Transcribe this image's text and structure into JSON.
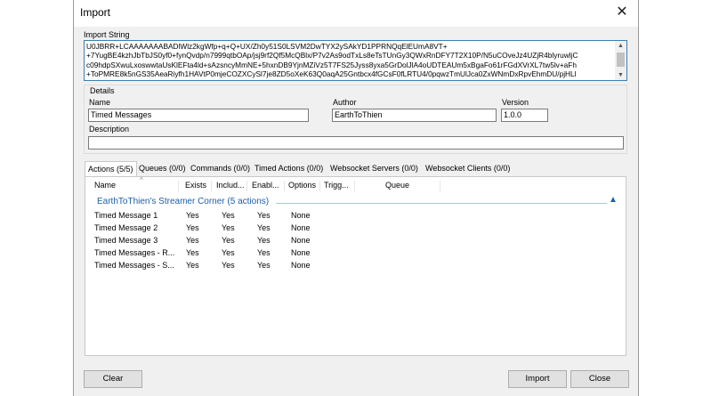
{
  "window": {
    "title": "Import",
    "close_glyph": "✕"
  },
  "import_string": {
    "label": "Import String",
    "lines": [
      "U0JBRR+LCAAAAAAABADlWlz2kgWfp+q+Q+UX/Zh0y51S0LSVM2DwTYX2ySAkYD1PPRNQqElEUmA8VT+",
      "+7YugBE4kzhJbTbJS0yf0+fynQvdp/n7999qtbOAp/jsj9rf2Qf5McQBlx/P7v2As9odTxLs8eTsTUnGy3QWxRnDFY7T2X10P/N5uCOveJz4UZjR4blyruwljC",
      "c09hdpSXwuLxoswwtaUsKlEFta4ld+sAzsncyMmNE+5hxnDB9YjnMZiVz5T7FS25Jyss8yxa5GrDolJlA4oUDTEAUm5xBgaFo61rFGdXVrXL7tw5lv+aFh",
      "+ToPMRE8k5nGS35AeaRiyfh1HAVtP0mjeCOZXCySl7je8ZD5oXeK63Q0aqA25Gntbcx4fGCsF0fLRTU4/0pqwzTmUlJca0ZxWNmDxRpvEhmDU/pjHLl"
    ]
  },
  "details": {
    "label": "Details",
    "name_label": "Name",
    "name_value": "Timed Messages",
    "author_label": "Author",
    "author_value": "EarthToThien",
    "version_label": "Version",
    "version_value": "1.0.0",
    "description_label": "Description",
    "description_value": ""
  },
  "tabs": [
    {
      "label": "Actions (5/5)"
    },
    {
      "label": "Queues (0/0)"
    },
    {
      "label": "Commands (0/0)"
    },
    {
      "label": "Timed Actions (0/0)"
    },
    {
      "label": "Websocket Servers (0/0)"
    },
    {
      "label": "Websocket Clients (0/0)"
    }
  ],
  "table": {
    "columns": [
      "Name",
      "Exists",
      "Includ...",
      "Enabl...",
      "Options",
      "Trigg...",
      "Queue"
    ],
    "group_label": "EarthToThien's Streamer Corner (5 actions)",
    "rows": [
      [
        "Timed Message 1",
        "Yes",
        "Yes",
        "Yes",
        "None"
      ],
      [
        "Timed Message 2",
        "Yes",
        "Yes",
        "Yes",
        "None"
      ],
      [
        "Timed Message 3",
        "Yes",
        "Yes",
        "Yes",
        "None"
      ],
      [
        "Timed Messages - R...",
        "Yes",
        "Yes",
        "Yes",
        "None"
      ],
      [
        "Timed Messages - S...",
        "Yes",
        "Yes",
        "Yes",
        "None"
      ]
    ]
  },
  "buttons": {
    "clear": "Clear",
    "import": "Import",
    "close": "Close"
  },
  "colors": {
    "accent": "#3c7fb1",
    "group_text": "#1e5fa8"
  }
}
